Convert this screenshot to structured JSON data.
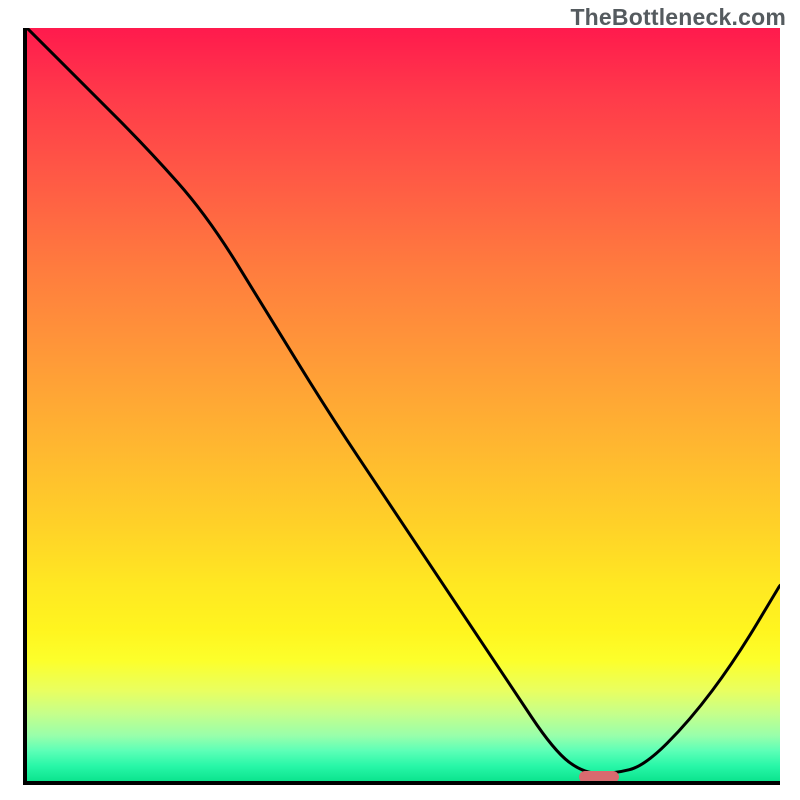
{
  "watermark": "TheBottleneck.com",
  "chart_data": {
    "type": "line",
    "title": "",
    "xlabel": "",
    "ylabel": "",
    "xlim": [
      0,
      100
    ],
    "ylim": [
      0,
      100
    ],
    "grid": false,
    "legend": false,
    "series": [
      {
        "name": "bottleneck-curve",
        "x": [
          0,
          8,
          16,
          24,
          32,
          40,
          48,
          56,
          64,
          70,
          74,
          78,
          82,
          88,
          94,
          100
        ],
        "values": [
          100,
          92,
          84,
          75,
          62,
          49,
          37,
          25,
          13,
          4,
          1,
          1,
          2,
          8,
          16,
          26
        ]
      }
    ],
    "marker": {
      "x": 76,
      "y": 0.5,
      "width_pct": 5.3,
      "height_pct": 1.6,
      "color": "#d86a6f"
    },
    "background": "vertical-gradient red→orange→yellow→green"
  }
}
